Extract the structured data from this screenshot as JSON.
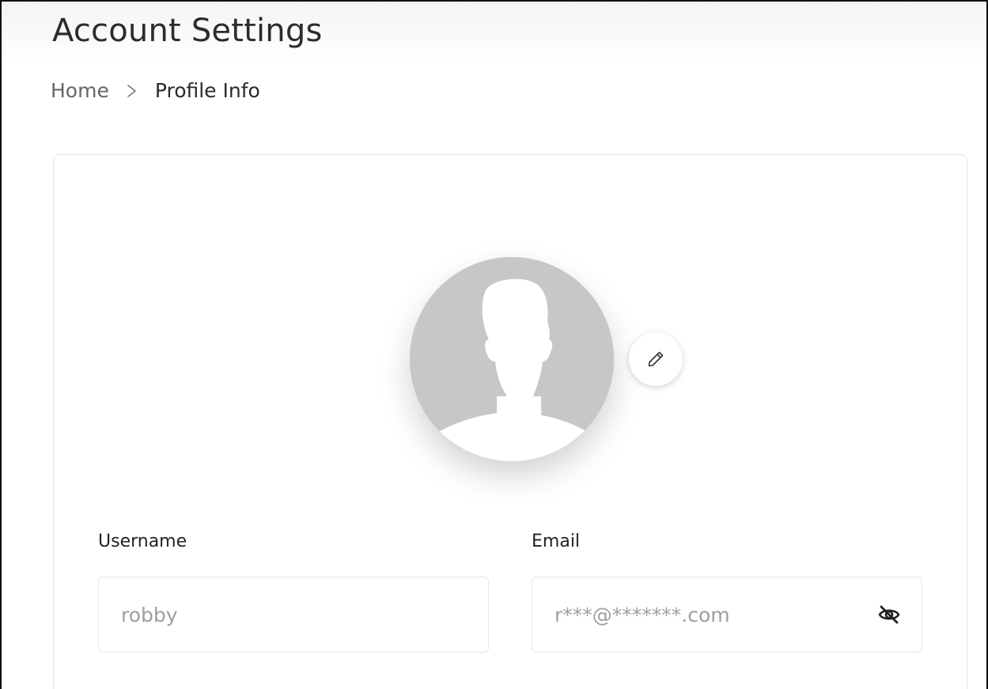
{
  "header": {
    "title": "Account Settings"
  },
  "breadcrumb": {
    "home": "Home",
    "current": "Profile Info"
  },
  "profile": {
    "avatar_icon": "user-silhouette-icon",
    "edit_icon": "pencil-icon"
  },
  "fields": {
    "username": {
      "label": "Username",
      "value": "robby"
    },
    "email": {
      "label": "Email",
      "value": "r***@*******.com",
      "toggle_icon": "eye-off-icon"
    }
  },
  "colors": {
    "avatar_bg": "#c7c7c7",
    "text_primary": "#2c2c2c",
    "text_muted": "#9e9e9e"
  }
}
